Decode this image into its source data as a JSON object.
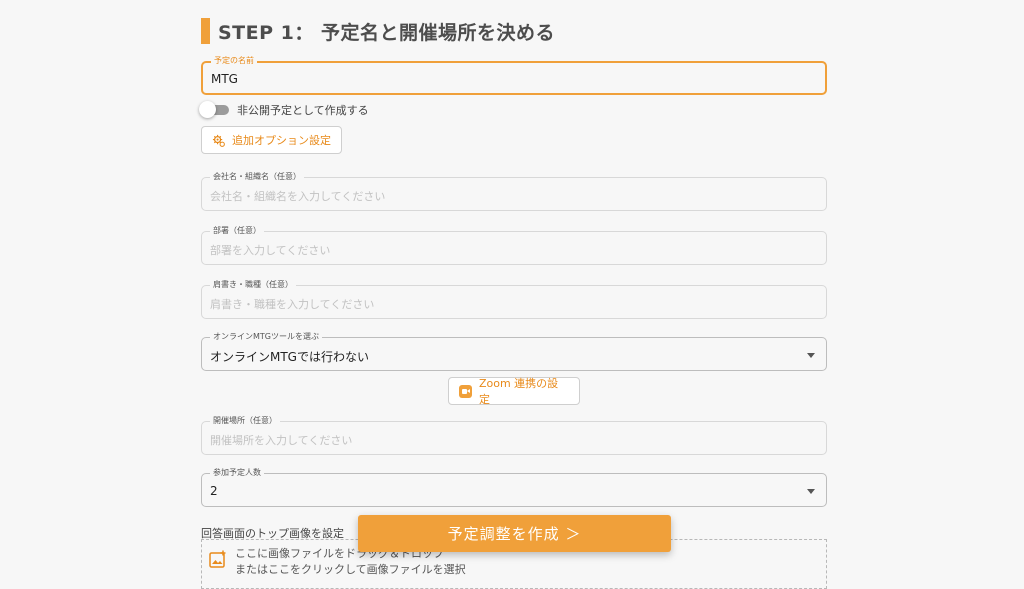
{
  "step": {
    "title": "STEP 1： 予定名と開催場所を決める"
  },
  "event_name": {
    "label": "予定の名前",
    "value": "MTG"
  },
  "private_toggle": {
    "label": "非公開予定として作成する",
    "state": "off"
  },
  "option_button": {
    "label": "追加オプション設定"
  },
  "company": {
    "label": "会社名・組織名（任意）",
    "placeholder": "会社名・組織名を入力してください"
  },
  "department": {
    "label": "部署（任意）",
    "placeholder": "部署を入力してください"
  },
  "title_field": {
    "label": "肩書き・職種（任意）",
    "placeholder": "肩書き・職種を入力してください"
  },
  "online_tool": {
    "label": "オンラインMTGツールを選ぶ",
    "value": "オンラインMTGでは行わない"
  },
  "zoom_button": {
    "label": "Zoom 連携の設定"
  },
  "venue": {
    "label": "開催場所（任意）",
    "placeholder": "開催場所を入力してください"
  },
  "attendees": {
    "label": "参加予定人数",
    "value": "2"
  },
  "top_image": {
    "label": "回答画面のトップ画像を設定",
    "line1": "ここに画像ファイルをドラッグ＆ドロップ",
    "line2": "またはここをクリックして画像ファイルを選択"
  },
  "submit": {
    "label": "予定調整を作成 ＞"
  },
  "colors": {
    "accent": "#f0a03a",
    "background": "#f7f7f7"
  }
}
